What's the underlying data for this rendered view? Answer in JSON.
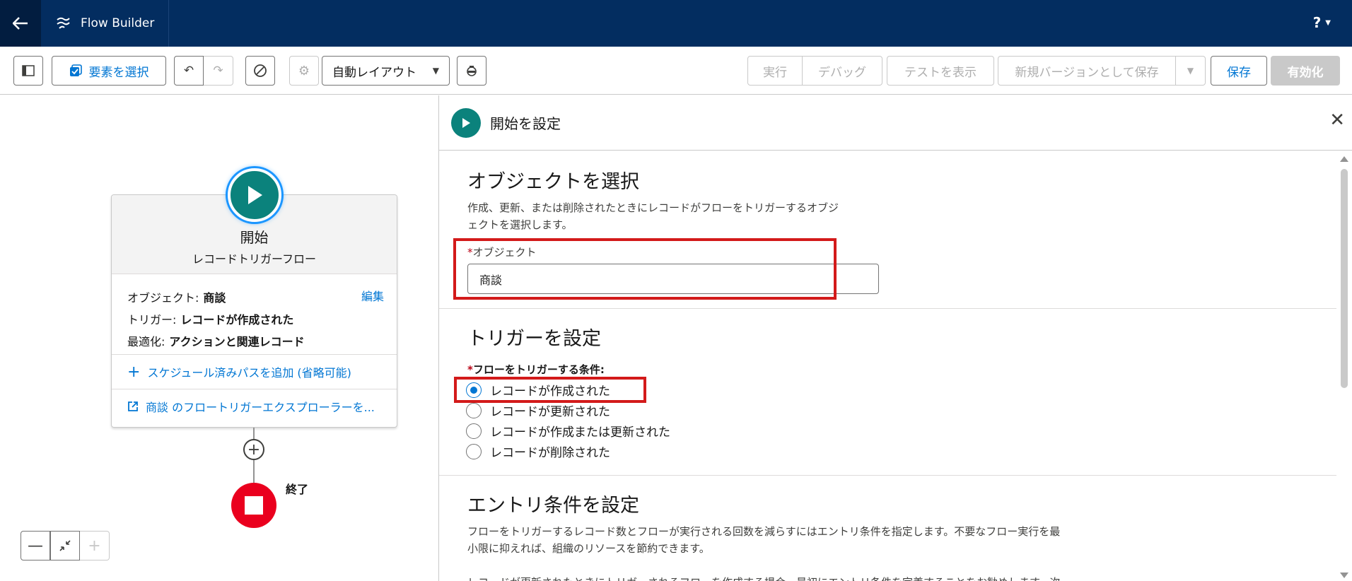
{
  "app": {
    "title": "Flow Builder",
    "help": "?"
  },
  "toolbar": {
    "select_elements": "要素を選択",
    "layout_value": "自動レイアウト",
    "run": "実行",
    "debug": "デバッグ",
    "view_tests": "テストを表示",
    "save_as_new_version": "新規バージョンとして保存",
    "save": "保存",
    "activate": "有効化"
  },
  "canvas": {
    "start": {
      "title": "開始",
      "subtitle": "レコードトリガーフロー",
      "object_label": "オブジェクト:",
      "object_value": "商談",
      "trigger_label": "トリガー:",
      "trigger_value": "レコードが作成された",
      "optimize_label": "最適化:",
      "optimize_value": "アクションと関連レコード",
      "edit": "編集",
      "add_scheduled_path": "スケジュール済みパスを追加 (省略可能)",
      "explorer_link": "商談 のフロートリガーエクスプローラーを..."
    },
    "end_label": "終了"
  },
  "panel": {
    "title": "開始を設定",
    "object_section": {
      "heading": "オブジェクトを選択",
      "description_line1": "作成、更新、または削除されたときにレコードがフローをトリガーするオブジ",
      "description_line2": "ェクトを選択します。",
      "field_label": "オブジェクト",
      "field_value": "商談"
    },
    "trigger_section": {
      "heading": "トリガーを設定",
      "field_label": "フローをトリガーする条件:",
      "options": [
        "レコードが作成された",
        "レコードが更新された",
        "レコードが作成または更新された",
        "レコードが削除された"
      ],
      "selected": "レコードが作成された"
    },
    "entry_section": {
      "heading": "エントリ条件を設定",
      "description_line1": "フローをトリガーするレコード数とフローが実行される回数を減らすにはエントリ条件を指定します。不要なフロー実行を最",
      "description_line2": "小限に抑えれば、組織のリソースを節約できます。",
      "description_line3": "レコードが更新されたときにトリガーされるフローを作成する場合、最初にエントリ条件を定義することをお勧めします。次"
    }
  },
  "colors": {
    "nav": "#032d60",
    "accent": "#0176d3",
    "start_node": "#0b827c",
    "end_node": "#ea001e",
    "highlight": "#d31a1a"
  }
}
